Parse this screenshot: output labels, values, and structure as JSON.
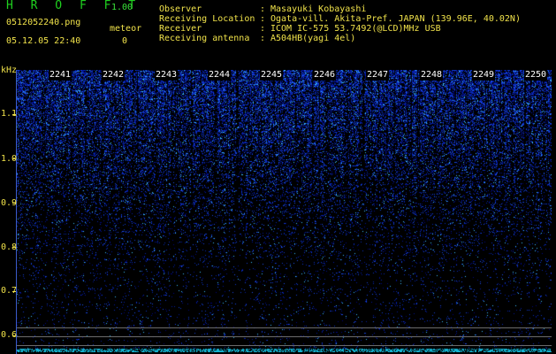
{
  "header": {
    "app_name": "H R O F F T",
    "version": "1.00",
    "file_name": "0512052240.png",
    "datetime": "05.12.05 22:40",
    "meteor_label": "meteor",
    "meteor_count": "0",
    "info": [
      {
        "key": "Observer",
        "value": "Masayuki Kobayashi"
      },
      {
        "key": "Receiving Location",
        "value": "Ogata-vill. Akita-Pref. JAPAN (139.96E, 40.02N)"
      },
      {
        "key": "Receiver",
        "value": "ICOM IC-575 53.7492(@LCD)MHz USB"
      },
      {
        "key": "Receiving antenna",
        "value": "A504HB(yagi 4el)"
      }
    ]
  },
  "plot": {
    "y_unit": "kHz",
    "y_ticks": [
      "1.1",
      "1.0",
      "0.9",
      "0.8",
      "0.7",
      "0.6"
    ],
    "time_labels": [
      "2241",
      "2242",
      "2243",
      "2244",
      "2245",
      "2246",
      "2247",
      "2248",
      "2249",
      "2250"
    ],
    "colors": {
      "background": "#000000",
      "signal": "#1e50ff",
      "grid": "#6b6b6b",
      "baseline": "#20d0e0"
    }
  }
}
